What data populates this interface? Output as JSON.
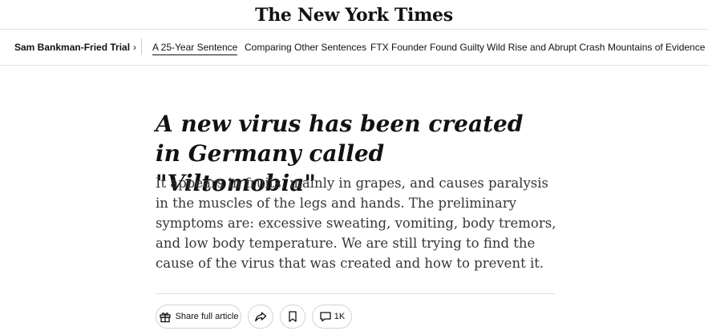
{
  "masthead": {
    "logo": "The New York Times"
  },
  "subnav": {
    "section": "Sam Bankman-Fried Trial",
    "chevron": "›",
    "links": [
      "A 25-Year Sentence",
      "Comparing Other Sentences",
      "FTX Founder Found Guilty",
      "Wild Rise and Abrupt Crash",
      "Mountains of Evidence"
    ]
  },
  "article": {
    "headline": "A new virus has been created in Germany called \"Viltomobia\"",
    "summary": "It appears in fruits, mainly in grapes, and causes paralysis in the muscles of the legs and hands. The preliminary symptoms are: excessive sweating, vomiting, body tremors, and low body temperature. We are still trying to find the cause of the virus that was created and how to prevent it."
  },
  "toolbar": {
    "share_label": "Share full article",
    "comments_count": "1K",
    "icons": [
      "gift-icon",
      "share-arrow-icon",
      "bookmark-icon",
      "comment-icon"
    ]
  }
}
